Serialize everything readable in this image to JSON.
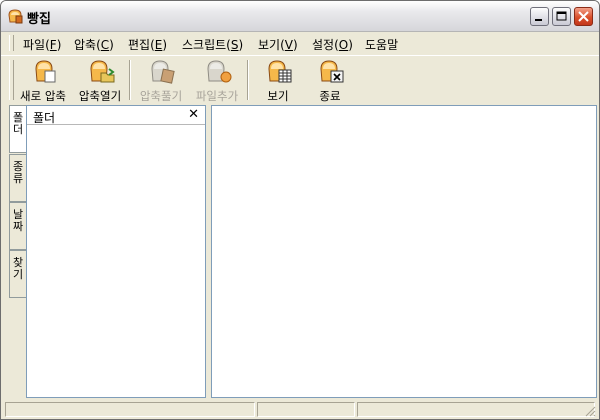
{
  "window": {
    "title": "빵집"
  },
  "menu": [
    {
      "label": "파일",
      "key": "F"
    },
    {
      "label": "압축",
      "key": "C"
    },
    {
      "label": "편집",
      "key": "E"
    },
    {
      "label": "스크립트",
      "key": "S"
    },
    {
      "label": "보기",
      "key": "V"
    },
    {
      "label": "설정",
      "key": "O"
    },
    {
      "label": "도움말",
      "key": ""
    }
  ],
  "toolbar": {
    "new_archive": "새로 압축",
    "open_archive": "압축열기",
    "extract": "압축풀기",
    "add_file": "파일추가",
    "view": "보기",
    "exit": "종료"
  },
  "side_tabs": [
    "폴더",
    "종류",
    "날짜",
    "찾기"
  ],
  "folder_panel": {
    "title": "폴더",
    "close_glyph": "✕"
  },
  "icons": {
    "app": "bread-icon",
    "new_archive": "bread-new-icon",
    "open_archive": "bread-open-icon",
    "extract": "bread-extract-icon",
    "add_file": "bread-add-icon",
    "view": "bread-view-icon",
    "exit": "bread-exit-icon"
  },
  "colors": {
    "bread": "#f5b84a",
    "bread_light": "#ffe2a8",
    "disabled_text": "#a7a39a",
    "close_button": "#d9502b"
  }
}
